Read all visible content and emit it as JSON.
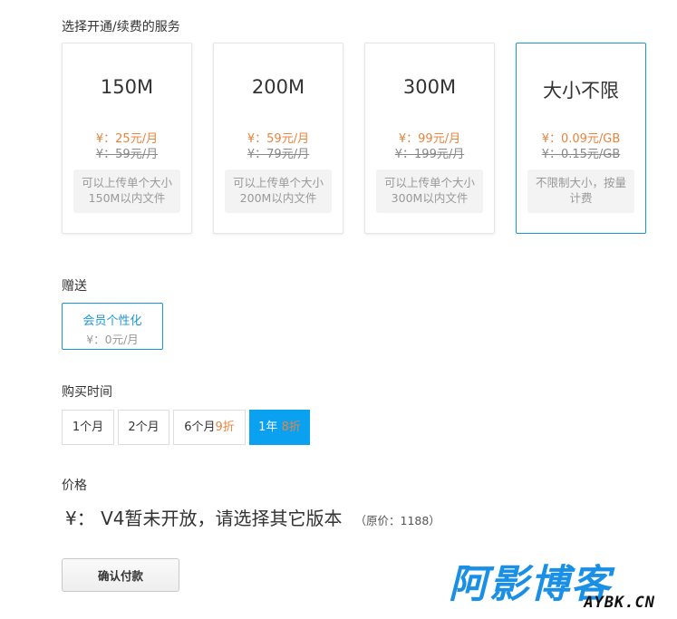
{
  "service_label": "选择开通/续费的服务",
  "plans": [
    {
      "title": "150M",
      "price": "¥：25元/月",
      "original": "¥：59元/月",
      "desc_line1": "可以上传单个大小",
      "desc_line2": "150M以内文件"
    },
    {
      "title": "200M",
      "price": "¥：59元/月",
      "original": "¥：79元/月",
      "desc_line1": "可以上传单个大小",
      "desc_line2": "200M以内文件"
    },
    {
      "title": "300M",
      "price": "¥：99元/月",
      "original": "¥：199元/月",
      "desc_line1": "可以上传单个大小",
      "desc_line2": "300M以内文件"
    },
    {
      "title": "大小不限",
      "price": "¥：0.09元/GB",
      "original": "¥：0.15元/GB",
      "desc_line1": "不限制大小，按量",
      "desc_line2": "计费"
    }
  ],
  "selected_plan": "大小不限",
  "gift": {
    "label": "赠送",
    "name": "会员个性化",
    "price": "¥：0元/月"
  },
  "duration": {
    "label": "购买时间",
    "options": [
      {
        "text": "1个月",
        "discount": ""
      },
      {
        "text": "2个月",
        "discount": ""
      },
      {
        "text": "6个月",
        "discount": "9折"
      },
      {
        "text": "1年",
        "discount": "8折"
      }
    ],
    "selected": "1年"
  },
  "price": {
    "label": "价格",
    "value": "¥： V4暂未开放，请选择其它版本",
    "original": "（原价：1188）"
  },
  "confirm_label": "确认付款",
  "watermark": {
    "main": "阿影博客",
    "sub": "AYBK.CN"
  },
  "colors": {
    "accent": "#1b97d1",
    "active": "#0aa1f0",
    "price": "#e8843f"
  }
}
